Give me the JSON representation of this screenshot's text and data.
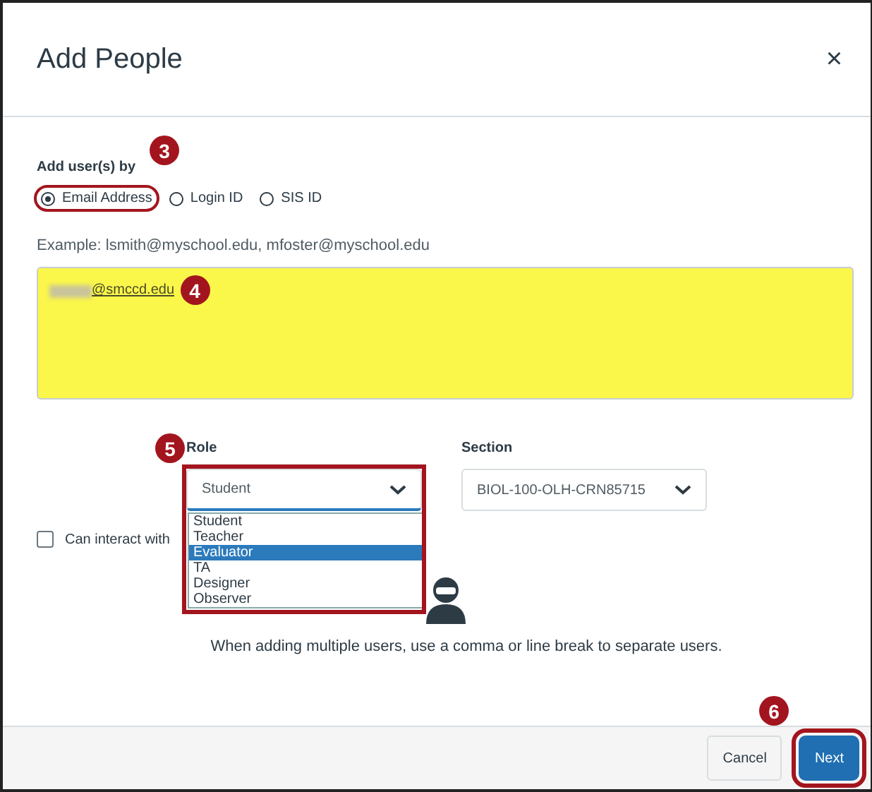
{
  "dialog": {
    "title": "Add People",
    "close": "×"
  },
  "add_by": {
    "label": "Add user(s) by",
    "badge": "3",
    "options": [
      {
        "label": "Email Address",
        "selected": true,
        "highlighted": true
      },
      {
        "label": "Login ID",
        "selected": false,
        "highlighted": false
      },
      {
        "label": "SIS ID",
        "selected": false,
        "highlighted": false
      }
    ]
  },
  "example": "Example: lsmith@myschool.edu, mfoster@myschool.edu",
  "users_field": {
    "value": "@smccd.edu",
    "redacted": true,
    "badge": "4",
    "highlighted_background": true
  },
  "role": {
    "label": "Role",
    "badge": "5",
    "value": "Student",
    "expanded": true,
    "highlighted": true,
    "options": [
      {
        "label": "Student",
        "highlighted": false
      },
      {
        "label": "Teacher",
        "highlighted": false
      },
      {
        "label": "Evaluator",
        "highlighted": true
      },
      {
        "label": "TA",
        "highlighted": false
      },
      {
        "label": "Designer",
        "highlighted": false
      },
      {
        "label": "Observer",
        "highlighted": false
      }
    ]
  },
  "section": {
    "label": "Section",
    "value": "BIOL-100-OLH-CRN85715"
  },
  "interact_checkbox": {
    "label": "Can interact with",
    "checked": false
  },
  "hint": "When adding multiple users, use a comma or line break to separate users.",
  "footer": {
    "badge": "6",
    "buttons": [
      {
        "label": "Cancel",
        "kind": "secondary",
        "highlighted": false
      },
      {
        "label": "Next",
        "kind": "primary",
        "highlighted": true
      }
    ]
  }
}
